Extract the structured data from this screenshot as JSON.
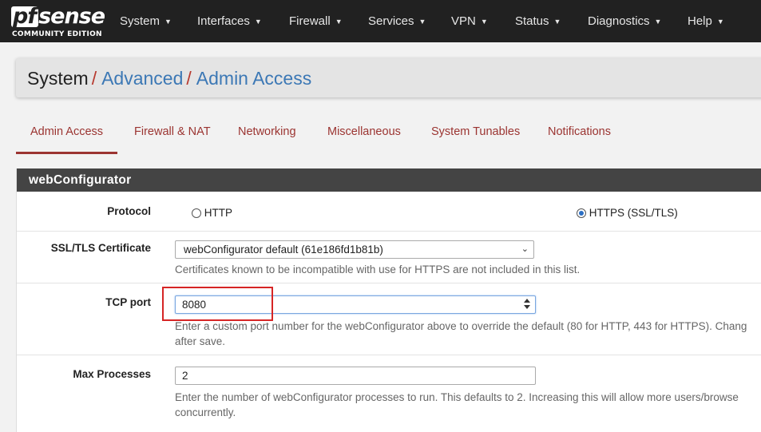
{
  "logo": {
    "text_pf": "pf",
    "text_sense": "sense",
    "edition": "COMMUNITY EDITION"
  },
  "nav": [
    {
      "label": "System"
    },
    {
      "label": "Interfaces"
    },
    {
      "label": "Firewall"
    },
    {
      "label": "Services"
    },
    {
      "label": "VPN"
    },
    {
      "label": "Status"
    },
    {
      "label": "Diagnostics"
    },
    {
      "label": "Help"
    }
  ],
  "breadcrumb": {
    "root": "System",
    "level1": "Advanced",
    "level2": "Admin Access",
    "separator": "/"
  },
  "tabs": [
    {
      "label": "Admin Access",
      "active": true
    },
    {
      "label": "Firewall & NAT"
    },
    {
      "label": "Networking"
    },
    {
      "label": "Miscellaneous"
    },
    {
      "label": "System Tunables"
    },
    {
      "label": "Notifications"
    }
  ],
  "panel": {
    "title": "webConfigurator",
    "protocol": {
      "label": "Protocol",
      "opt_http": "HTTP",
      "opt_https": "HTTPS (SSL/TLS)",
      "selected": "HTTPS (SSL/TLS)"
    },
    "certificate": {
      "label": "SSL/TLS Certificate",
      "value": "webConfigurator default (61e186fd1b81b)",
      "help": "Certificates known to be incompatible with use for HTTPS are not included in this list."
    },
    "tcp_port": {
      "label": "TCP port",
      "value": "8080",
      "help_line1": "Enter a custom port number for the webConfigurator above to override the default (80 for HTTP, 443 for HTTPS). Chang",
      "help_line2": "after save."
    },
    "max_processes": {
      "label": "Max Processes",
      "value": "2",
      "help_line1": "Enter the number of webConfigurator processes to run. This defaults to 2. Increasing this will allow more users/browse",
      "help_line2": "concurrently."
    }
  },
  "colors": {
    "navbar": "#212121",
    "accent_red": "#9b3431",
    "link_blue": "#3c78b5",
    "panel_heading": "#444444",
    "highlight": "#d62525"
  }
}
